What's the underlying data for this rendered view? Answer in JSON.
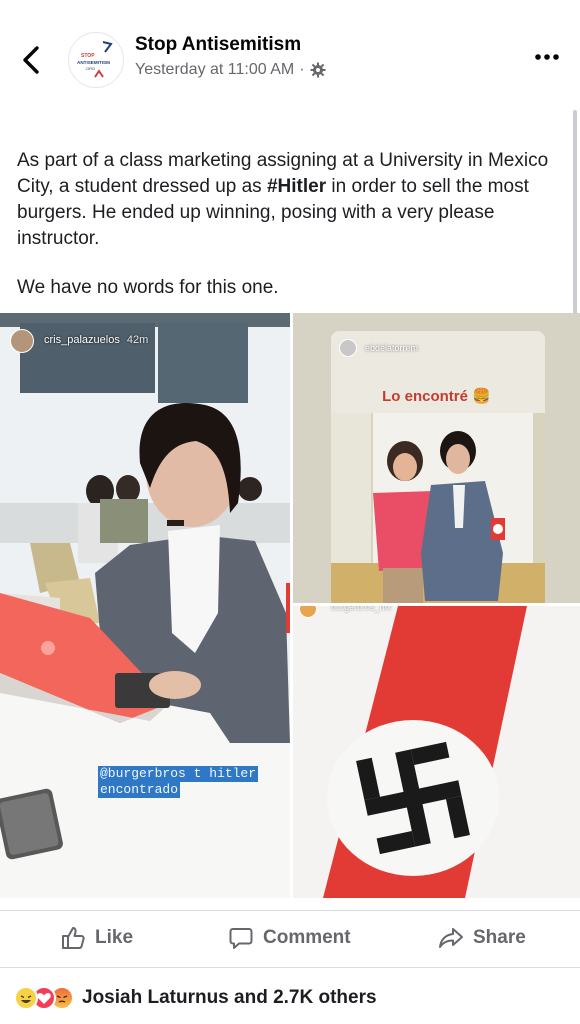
{
  "header": {
    "page_name": "Stop Antisemitism",
    "timestamp": "Yesterday at 11:00 AM",
    "separator": "·",
    "logo_text_1": "STOP",
    "logo_text_2": "ANTISEMITISM",
    "logo_text_3": ".ORG"
  },
  "post": {
    "text_before": "As part of a class marketing assigning at a University in Mexico City, a student dressed up as ",
    "hashtag": "#Hitler",
    "text_after": " in order to sell the most burgers. He ended up winning, posing with a very please instructor.",
    "text_2": "We have no words for this one."
  },
  "photos": {
    "photo1": {
      "username": "cris_palazuelos",
      "age": "42m",
      "caption_line1": "@burgerbros t hitler",
      "caption_line2": "encontrado"
    },
    "photo2": {
      "username": "ebdelatorrem",
      "caption": "Lo encontré",
      "emoji": "🍔"
    },
    "photo3": {
      "username": "burgerbros_mx"
    }
  },
  "actions": {
    "like": "Like",
    "comment": "Comment",
    "share": "Share"
  },
  "reactions": {
    "summary": "Josiah Laturnus and 2.7K others",
    "types": [
      "haha-icon",
      "love-icon",
      "angry-icon"
    ]
  },
  "colors": {
    "text_primary": "#1c1e21",
    "text_secondary": "#65676b",
    "armband_red": "#e23a35",
    "laptop": "#f2665c"
  }
}
